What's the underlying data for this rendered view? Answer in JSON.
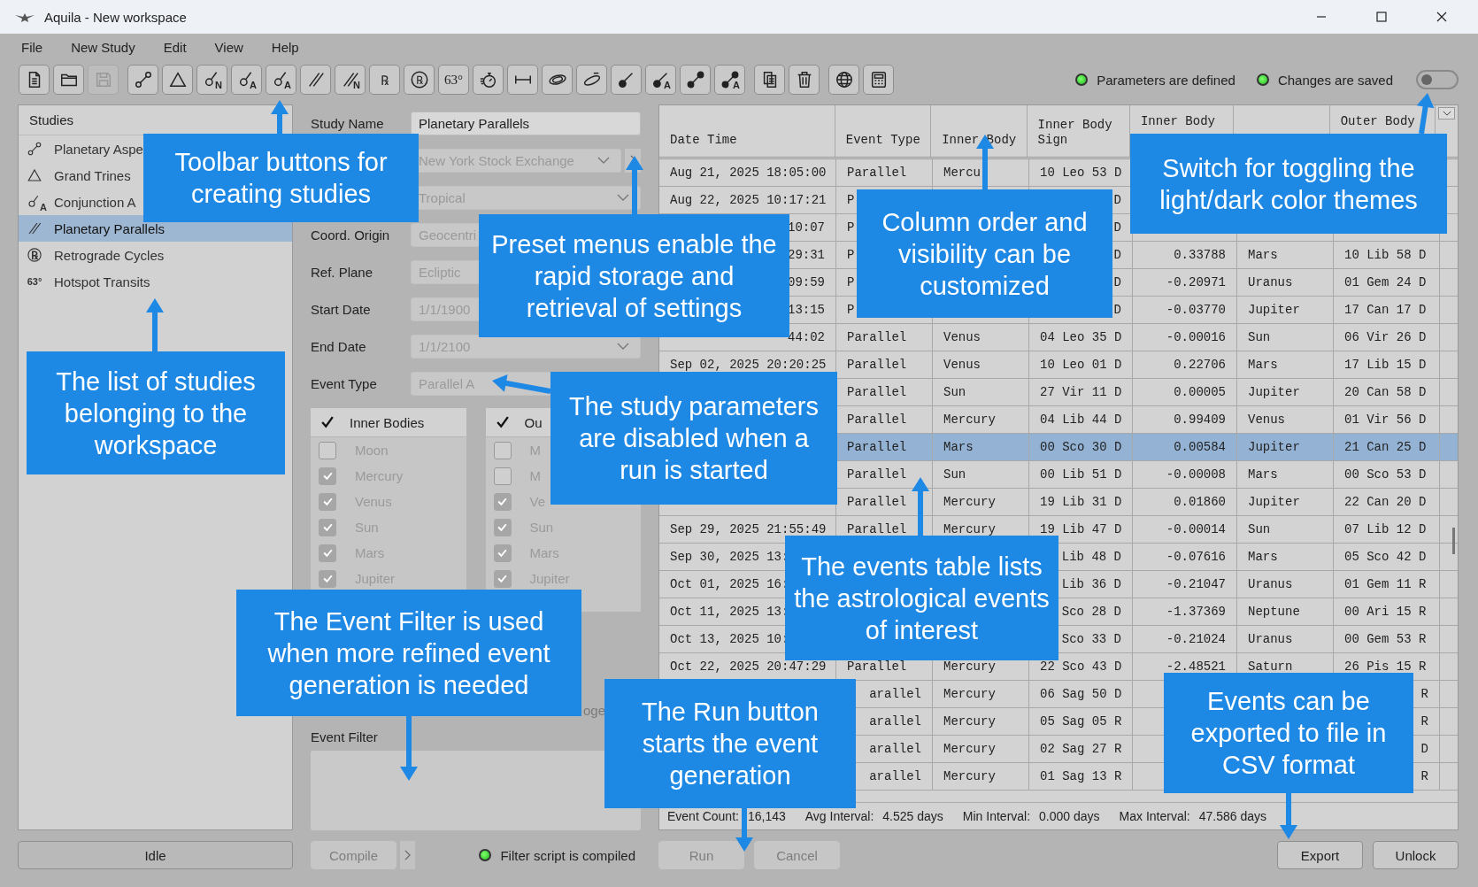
{
  "window": {
    "title": "Aquila - New workspace"
  },
  "menu": [
    "File",
    "New Study",
    "Edit",
    "View",
    "Help"
  ],
  "toolbar": [
    [
      {
        "kind": "document",
        "disabled": false
      },
      {
        "kind": "folder",
        "disabled": false
      },
      {
        "kind": "save",
        "disabled": true
      }
    ],
    [
      {
        "kind": "aspect",
        "disabled": false
      },
      {
        "kind": "trine",
        "disabled": false
      },
      {
        "kind": "conjunction",
        "glyph": "N",
        "disabled": false
      },
      {
        "kind": "conjunction",
        "glyph": "A",
        "disabled": false
      },
      {
        "kind": "conjunction",
        "glyph": "A",
        "disabled": false
      },
      {
        "kind": "parallel",
        "disabled": false
      },
      {
        "kind": "parallel",
        "glyph": "N",
        "disabled": false
      },
      {
        "kind": "letter",
        "glyph": "℞",
        "disabled": false
      },
      {
        "kind": "ring",
        "glyph": "℞",
        "disabled": false
      },
      {
        "kind": "letter",
        "glyph": "63°",
        "disabled": false
      },
      {
        "kind": "stopwatch",
        "disabled": false
      },
      {
        "kind": "interval",
        "disabled": false
      },
      {
        "kind": "orbit",
        "disabled": false
      },
      {
        "kind": "ellipse",
        "disabled": false
      },
      {
        "kind": "dot-line",
        "disabled": false
      },
      {
        "kind": "dot-line",
        "glyph": "A",
        "disabled": false
      },
      {
        "kind": "dot-line-dot",
        "disabled": false
      },
      {
        "kind": "dot-line-dot",
        "glyph": "A",
        "disabled": false
      }
    ],
    [
      {
        "kind": "copy",
        "disabled": false
      },
      {
        "kind": "trash",
        "disabled": false
      }
    ],
    [
      {
        "kind": "globe",
        "disabled": false
      },
      {
        "kind": "calculator",
        "disabled": false
      }
    ]
  ],
  "status": [
    {
      "label": "Parameters are defined",
      "on": true
    },
    {
      "label": "Changes are saved",
      "on": true
    }
  ],
  "theme_switch": {
    "on": false
  },
  "studies": {
    "title": "Studies",
    "items": [
      {
        "kind": "aspect",
        "label": "Planetary Aspe",
        "selected": false
      },
      {
        "kind": "trine",
        "label": "Grand Trines",
        "selected": false
      },
      {
        "kind": "conjunction",
        "glyph": "A",
        "label": "Conjunction A",
        "selected": false
      },
      {
        "kind": "parallel",
        "label": "Planetary Parallels",
        "selected": true
      },
      {
        "kind": "ring",
        "glyph": "℞",
        "label": "Retrograde Cycles",
        "selected": false
      },
      {
        "kind": "letter",
        "glyph": "63°",
        "label": "Hotspot Transits",
        "selected": false
      }
    ]
  },
  "run_state": "Idle",
  "parameters": {
    "fields": [
      {
        "label": "Study Name",
        "value": "Planetary Parallels",
        "kind": "text",
        "disabled": false
      },
      {
        "value": "New York Stock Exchange",
        "kind": "preset",
        "disabled": true
      },
      {
        "value": "Tropical",
        "kind": "select",
        "disabled": true
      },
      {
        "label": "Coord. Origin",
        "value": "Geocentri",
        "kind": "text",
        "disabled": true
      },
      {
        "label": "Ref. Plane",
        "value": "Ecliptic",
        "kind": "text",
        "disabled": true
      },
      {
        "label": "Start Date",
        "value": "1/1/1900",
        "kind": "text",
        "disabled": true
      },
      {
        "label": "End Date",
        "value": "1/1/2100",
        "kind": "select",
        "disabled": true
      },
      {
        "label": "Event Type",
        "value": "Parallel A",
        "kind": "text",
        "disabled": true
      }
    ],
    "bodies": [
      {
        "title": "Inner Bodies",
        "checked": true,
        "items": [
          {
            "label": "Moon",
            "checked": false
          },
          {
            "label": "Mercury",
            "checked": true
          },
          {
            "label": "Venus",
            "checked": true
          },
          {
            "label": "Sun",
            "checked": true
          },
          {
            "label": "Mars",
            "checked": true
          },
          {
            "label": "Jupiter",
            "checked": true
          }
        ]
      },
      {
        "title": "Ou",
        "checked": true,
        "items": [
          {
            "label": "M",
            "checked": false
          },
          {
            "label": "M",
            "checked": false
          },
          {
            "label": "Ve",
            "checked": true
          },
          {
            "label": "Sun",
            "checked": true
          },
          {
            "label": "Mars",
            "checked": true
          },
          {
            "label": "Jupiter",
            "checked": true
          }
        ]
      }
    ],
    "fragment": "oge",
    "event_filter": {
      "label": "Event Filter"
    },
    "compile": {
      "label": "Compile",
      "disabled": true
    },
    "filter_status": {
      "label": "Filter script is compiled",
      "on": true
    }
  },
  "table": {
    "columns": [
      {
        "label": "Date Time",
        "kind": "text",
        "clipped": false
      },
      {
        "label": "Event Type",
        "kind": "text",
        "clipped": false
      },
      {
        "label": "Inner Body",
        "kind": "text",
        "clipped": false
      },
      {
        "label": "Inner Body\nSign",
        "kind": "text",
        "clipped": false
      },
      {
        "label": "Inner Body",
        "kind": "number",
        "clipped": true
      },
      {
        "kind": "text"
      },
      {
        "label": "Outer Body",
        "kind": "text",
        "clipped": true
      }
    ],
    "rows": [
      {
        "selected": false,
        "cells": [
          "Aug 21, 2025 18:05:00",
          "Parallel",
          "Mercu",
          "10 Leo 53 D",
          null,
          null,
          null
        ]
      },
      {
        "selected": false,
        "cells": [
          "Aug 22, 2025 10:17:21",
          "P",
          null,
          {
            "text": "D",
            "clipped": true
          },
          null,
          null,
          null
        ]
      },
      {
        "selected": false,
        "cells": [
          {
            "text": "10:07",
            "clipped": true
          },
          "P",
          null,
          {
            "text": "D",
            "clipped": true
          },
          null,
          null,
          null
        ]
      },
      {
        "selected": false,
        "cells": [
          {
            "text": "29:31",
            "clipped": true
          },
          "P",
          null,
          {
            "text": "D",
            "clipped": true
          },
          "0.33788",
          "Mars",
          "10 Lib 58 D"
        ]
      },
      {
        "selected": false,
        "cells": [
          {
            "text": "09:59",
            "clipped": true
          },
          "P",
          null,
          {
            "text": "D",
            "clipped": true
          },
          "-0.20971",
          "Uranus",
          "01 Gem 24 D"
        ]
      },
      {
        "selected": false,
        "cells": [
          {
            "text": "13:15",
            "clipped": true
          },
          "P",
          null,
          {
            "text": "D",
            "clipped": true
          },
          "-0.03770",
          "Jupiter",
          "17 Can 17 D"
        ]
      },
      {
        "selected": false,
        "cells": [
          {
            "text": "44:02",
            "clipped": true
          },
          "Parallel",
          "Venus",
          "04 Leo 35 D",
          "-0.00016",
          "Sun",
          "06 Vir 26 D"
        ]
      },
      {
        "selected": false,
        "cells": [
          "Sep 02, 2025 20:20:25",
          "Parallel",
          "Venus",
          "10 Leo 01 D",
          "0.22706",
          "Mars",
          "17 Lib 15 D"
        ]
      },
      {
        "selected": false,
        "cells": [
          null,
          "Parallel",
          "Sun",
          "27 Vir 11 D",
          "0.00005",
          "Jupiter",
          "20 Can 58 D"
        ]
      },
      {
        "selected": false,
        "cells": [
          null,
          "Parallel",
          "Mercury",
          "04 Lib 44 D",
          "0.99409",
          "Venus",
          "01 Vir 56 D"
        ]
      },
      {
        "selected": true,
        "cells": [
          null,
          "Parallel",
          "Mars",
          "00 Sco 30 D",
          "0.00584",
          "Jupiter",
          "21 Can 25 D"
        ]
      },
      {
        "selected": false,
        "cells": [
          null,
          "Parallel",
          "Sun",
          "00 Lib 51 D",
          "-0.00008",
          "Mars",
          "00 Sco 53 D"
        ]
      },
      {
        "selected": false,
        "cells": [
          null,
          "Parallel",
          "Mercury",
          "19 Lib 31 D",
          "0.01860",
          "Jupiter",
          "22 Can 20 D"
        ]
      },
      {
        "selected": false,
        "cells": [
          "Sep 29, 2025 21:55:49",
          "Parallel",
          "Mercury",
          "19 Lib 47 D",
          "-0.00014",
          "Sun",
          "07 Lib 12 D"
        ]
      },
      {
        "selected": false,
        "cells": [
          "Sep 30, 2025 13:",
          null,
          null,
          {
            "text": "Lib 48 D",
            "clipped": true
          },
          "-0.07616",
          "Mars",
          "05 Sco 42 D"
        ]
      },
      {
        "selected": false,
        "cells": [
          "Oct 01, 2025 16:",
          null,
          null,
          {
            "text": "Lib 36 D",
            "clipped": true
          },
          "-0.21047",
          "Uranus",
          "01 Gem 11 R"
        ]
      },
      {
        "selected": false,
        "cells": [
          "Oct 11, 2025 13:",
          null,
          null,
          {
            "text": "Sco 28 D",
            "clipped": true
          },
          "-1.37369",
          "Neptune",
          "00 Ari 15 R"
        ]
      },
      {
        "selected": false,
        "cells": [
          "Oct 13, 2025 10:",
          null,
          null,
          {
            "text": "Sco 33 D",
            "clipped": true
          },
          "-0.21024",
          "Uranus",
          "00 Gem 53 R"
        ]
      },
      {
        "selected": false,
        "cells": [
          "Oct 22, 2025 20:47:29",
          "Parallel",
          "Mercury",
          "22 Sco 43 D",
          "-2.48521",
          "Saturn",
          "26 Pis 15 R"
        ]
      },
      {
        "selected": false,
        "cells": [
          null,
          {
            "text": "arallel",
            "clipped": true
          },
          "Mercury",
          "06 Sag 50 D",
          null,
          null,
          {
            "text": "R",
            "clipped": true
          }
        ]
      },
      {
        "selected": false,
        "cells": [
          null,
          {
            "text": "arallel",
            "clipped": true
          },
          "Mercury",
          "05 Sag 05 R",
          null,
          null,
          {
            "text": "R",
            "clipped": true
          }
        ]
      },
      {
        "selected": false,
        "cells": [
          null,
          {
            "text": "arallel",
            "clipped": true
          },
          "Mercury",
          "02 Sag 27 R",
          null,
          null,
          {
            "text": "D",
            "clipped": true
          }
        ]
      },
      {
        "selected": false,
        "cells": [
          null,
          {
            "text": "arallel",
            "clipped": true
          },
          "Mercury",
          "01 Sag 13 R",
          null,
          null,
          {
            "text": "R",
            "clipped": true
          }
        ]
      }
    ],
    "stats": [
      {
        "label": "Event Count:",
        "value": "16,143"
      },
      {
        "label": "Avg Interval:",
        "value": "4.525 days"
      },
      {
        "label": "Min Interval:",
        "value": "0.000 days"
      },
      {
        "label": "Max Interval:",
        "value": "47.586 days"
      }
    ]
  },
  "buttons": [
    {
      "label": "Run",
      "disabled": true
    },
    {
      "label": "Cancel",
      "disabled": true
    },
    {
      "label": "Export",
      "disabled": false
    },
    {
      "label": "Unlock",
      "disabled": false
    }
  ],
  "callouts": [
    "Toolbar buttons for creating studies",
    "Preset menus enable the rapid storage and retrieval of settings",
    "Column order and visibility can be customized",
    "Switch for toggling the light/dark color themes",
    "The list of studies belonging to the workspace",
    "The study parameters are disabled when a run is started",
    "The events table lists the astrological events of interest",
    "The Event Filter is used when more refined event generation is needed",
    "The Run button starts the event generation",
    "Events can be exported to file in CSV format"
  ]
}
